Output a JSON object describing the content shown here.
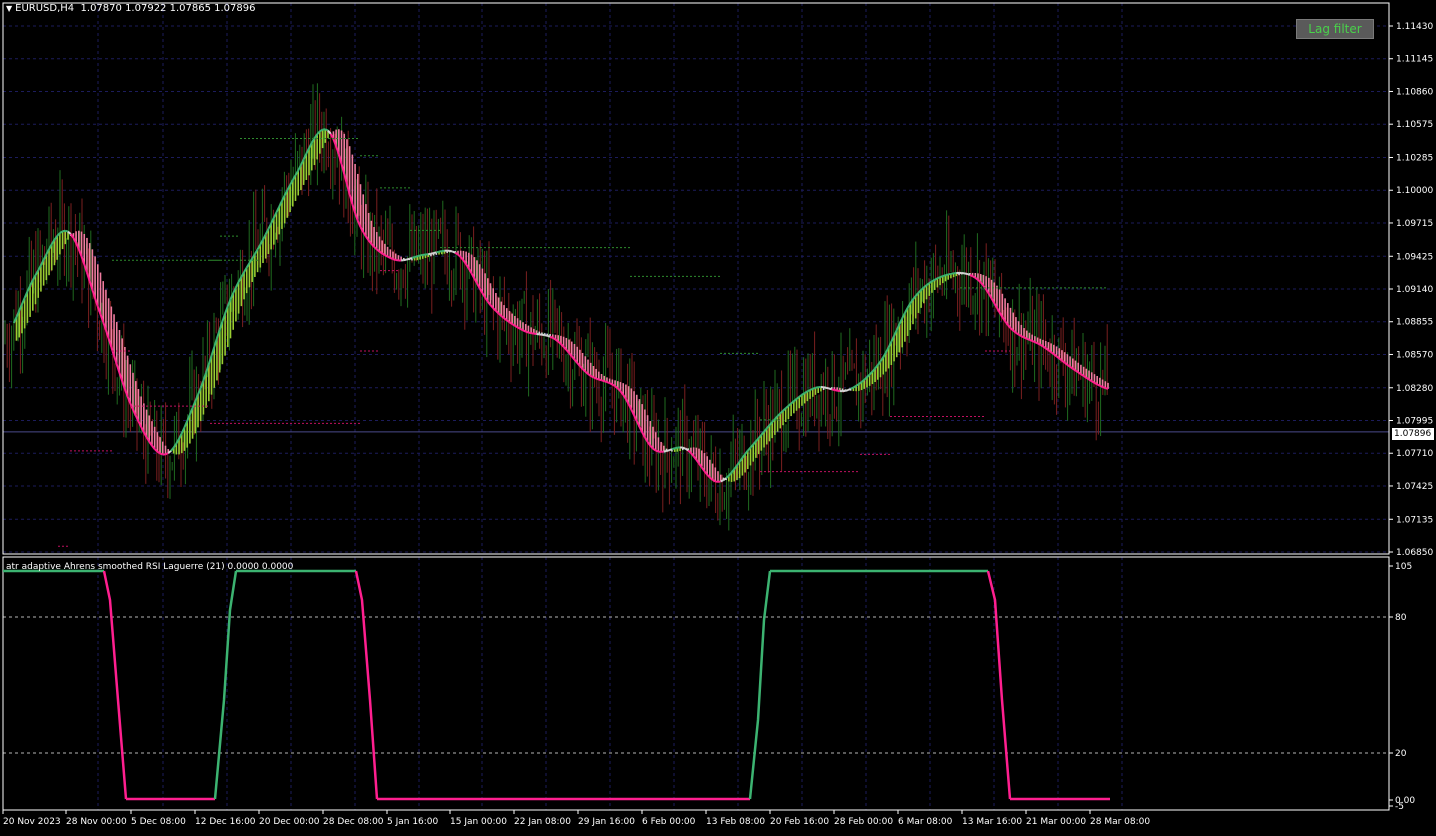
{
  "header": {
    "symbol": "EURUSD,H4",
    "ohlc": "1.07870 1.07922 1.07865 1.07896"
  },
  "lag_filter_button": {
    "label": "Lag filter"
  },
  "price_axis": {
    "labels": [
      "1.11430",
      "1.11145",
      "1.10860",
      "1.10575",
      "1.10285",
      "1.10000",
      "1.09715",
      "1.09425",
      "1.09140",
      "1.08855",
      "1.08570",
      "1.08280",
      "1.07995",
      "1.07710",
      "1.07425",
      "1.07135",
      "1.06850"
    ],
    "current_price": "1.07896"
  },
  "time_axis": {
    "labels": [
      "20 Nov 2023",
      "28 Nov 00:00",
      "5 Dec 08:00",
      "12 Dec 16:00",
      "20 Dec 00:00",
      "28 Dec 08:00",
      "5 Jan 16:00",
      "15 Jan 00:00",
      "22 Jan 08:00",
      "29 Jan 16:00",
      "6 Feb 00:00",
      "13 Feb 08:00",
      "20 Feb 16:00",
      "28 Feb 00:00",
      "6 Mar 08:00",
      "13 Mar 16:00",
      "21 Mar 00:00",
      "28 Mar 08:00"
    ]
  },
  "indicator": {
    "title": "atr adaptive Ahrens smoothed RSI Laguerre (21) 0.0000 0.0000",
    "axis_labels": [
      "105",
      "80",
      "20",
      "0.00",
      "-5"
    ],
    "levels": [
      80,
      20
    ]
  },
  "colors": {
    "background": "#000000",
    "grid": "#1c1c5c",
    "bull": "#9acd32",
    "bull_edge": "#3cb371",
    "bear": "#f07ca0",
    "bear_edge": "#ff1f8f",
    "neutral": "#d3d3d3",
    "axis_text": "#ffffff",
    "button_text": "#49d14b"
  },
  "chart_data": {
    "type": "line",
    "title": "EURUSD,H4",
    "xlabel": "",
    "ylabel": "",
    "ylim": [
      1.0685,
      1.1155
    ],
    "series": [
      {
        "values": [
          {
            "x": "20 Nov 2023",
            "y": 1.0869
          },
          {
            "x": "24 Nov 2023",
            "y": 1.0926
          },
          {
            "x": "28 Nov 00:00",
            "y": 1.0964
          },
          {
            "x": "1 Dec 2023",
            "y": 1.0892
          },
          {
            "x": "5 Dec 08:00",
            "y": 1.0809
          },
          {
            "x": "9 Dec 2023",
            "y": 1.077
          },
          {
            "x": "12 Dec 16:00",
            "y": 1.0822
          },
          {
            "x": "16 Dec 2023",
            "y": 1.0905
          },
          {
            "x": "20 Dec 00:00",
            "y": 1.0957
          },
          {
            "x": "24 Dec 2023",
            "y": 1.1013
          },
          {
            "x": "28 Dec 08:00",
            "y": 1.1052
          },
          {
            "x": "1 Jan 2024",
            "y": 1.0968
          },
          {
            "x": "5 Jan 16:00",
            "y": 1.094
          },
          {
            "x": "10 Jan 2024",
            "y": 1.0944
          },
          {
            "x": "15 Jan 00:00",
            "y": 1.0944
          },
          {
            "x": "18 Jan 2024",
            "y": 1.09
          },
          {
            "x": "22 Jan 08:00",
            "y": 1.0878
          },
          {
            "x": "25 Jan 2024",
            "y": 1.087
          },
          {
            "x": "29 Jan 16:00",
            "y": 1.084
          },
          {
            "x": "2 Feb 2024",
            "y": 1.0825
          },
          {
            "x": "6 Feb 00:00",
            "y": 1.0775
          },
          {
            "x": "10 Feb 2024",
            "y": 1.0775
          },
          {
            "x": "13 Feb 08:00",
            "y": 1.0746
          },
          {
            "x": "17 Feb 2024",
            "y": 1.0776
          },
          {
            "x": "20 Feb 16:00",
            "y": 1.0808
          },
          {
            "x": "25 Feb 2024",
            "y": 1.0828
          },
          {
            "x": "28 Feb 00:00",
            "y": 1.0826
          },
          {
            "x": "2 Mar 2024",
            "y": 1.0851
          },
          {
            "x": "6 Mar 08:00",
            "y": 1.0905
          },
          {
            "x": "10 Mar 2024",
            "y": 1.0926
          },
          {
            "x": "13 Mar 16:00",
            "y": 1.0922
          },
          {
            "x": "17 Mar 2024",
            "y": 1.088
          },
          {
            "x": "21 Mar 00:00",
            "y": 1.0864
          },
          {
            "x": "25 Mar 2024",
            "y": 1.0843
          },
          {
            "x": "28 Mar 08:00",
            "y": 1.0827
          }
        ]
      }
    ]
  }
}
